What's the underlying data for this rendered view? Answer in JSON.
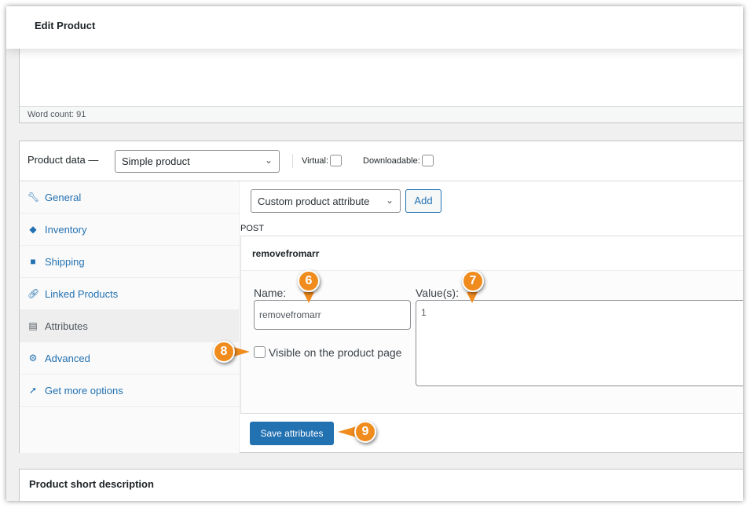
{
  "header": {
    "title": "Edit Product"
  },
  "editor": {
    "word_count": "Word count: 91"
  },
  "product_data": {
    "label": "Product data —",
    "type_select": "Simple product",
    "virtual_label": "Virtual:",
    "virtual_checked": false,
    "downloadable_label": "Downloadable:",
    "downloadable_checked": false,
    "tabs": [
      {
        "label": "General",
        "icon": "wrench-icon"
      },
      {
        "label": "Inventory",
        "icon": "tag-icon"
      },
      {
        "label": "Shipping",
        "icon": "truck-icon"
      },
      {
        "label": "Linked Products",
        "icon": "link-icon"
      },
      {
        "label": "Attributes",
        "icon": "list-icon",
        "active": true
      },
      {
        "label": "Advanced",
        "icon": "gear-icon"
      },
      {
        "label": "Get more options",
        "icon": "plugin-icon"
      }
    ],
    "attribute_select": "Custom product attribute",
    "add_label": "Add",
    "post_text": "POST",
    "attribute": {
      "title": "removefromarr",
      "name_label": "Name:",
      "name_value": "removefromarr",
      "values_label": "Value(s):",
      "values_value": "1",
      "visible_label": "Visible on the product page",
      "visible_checked": false
    },
    "save_label": "Save attributes"
  },
  "short_description": {
    "title": "Product short description"
  },
  "callouts": [
    "6",
    "7",
    "8",
    "9"
  ],
  "colors": {
    "accent": "#2271b1",
    "callout": "#f08c1e"
  }
}
